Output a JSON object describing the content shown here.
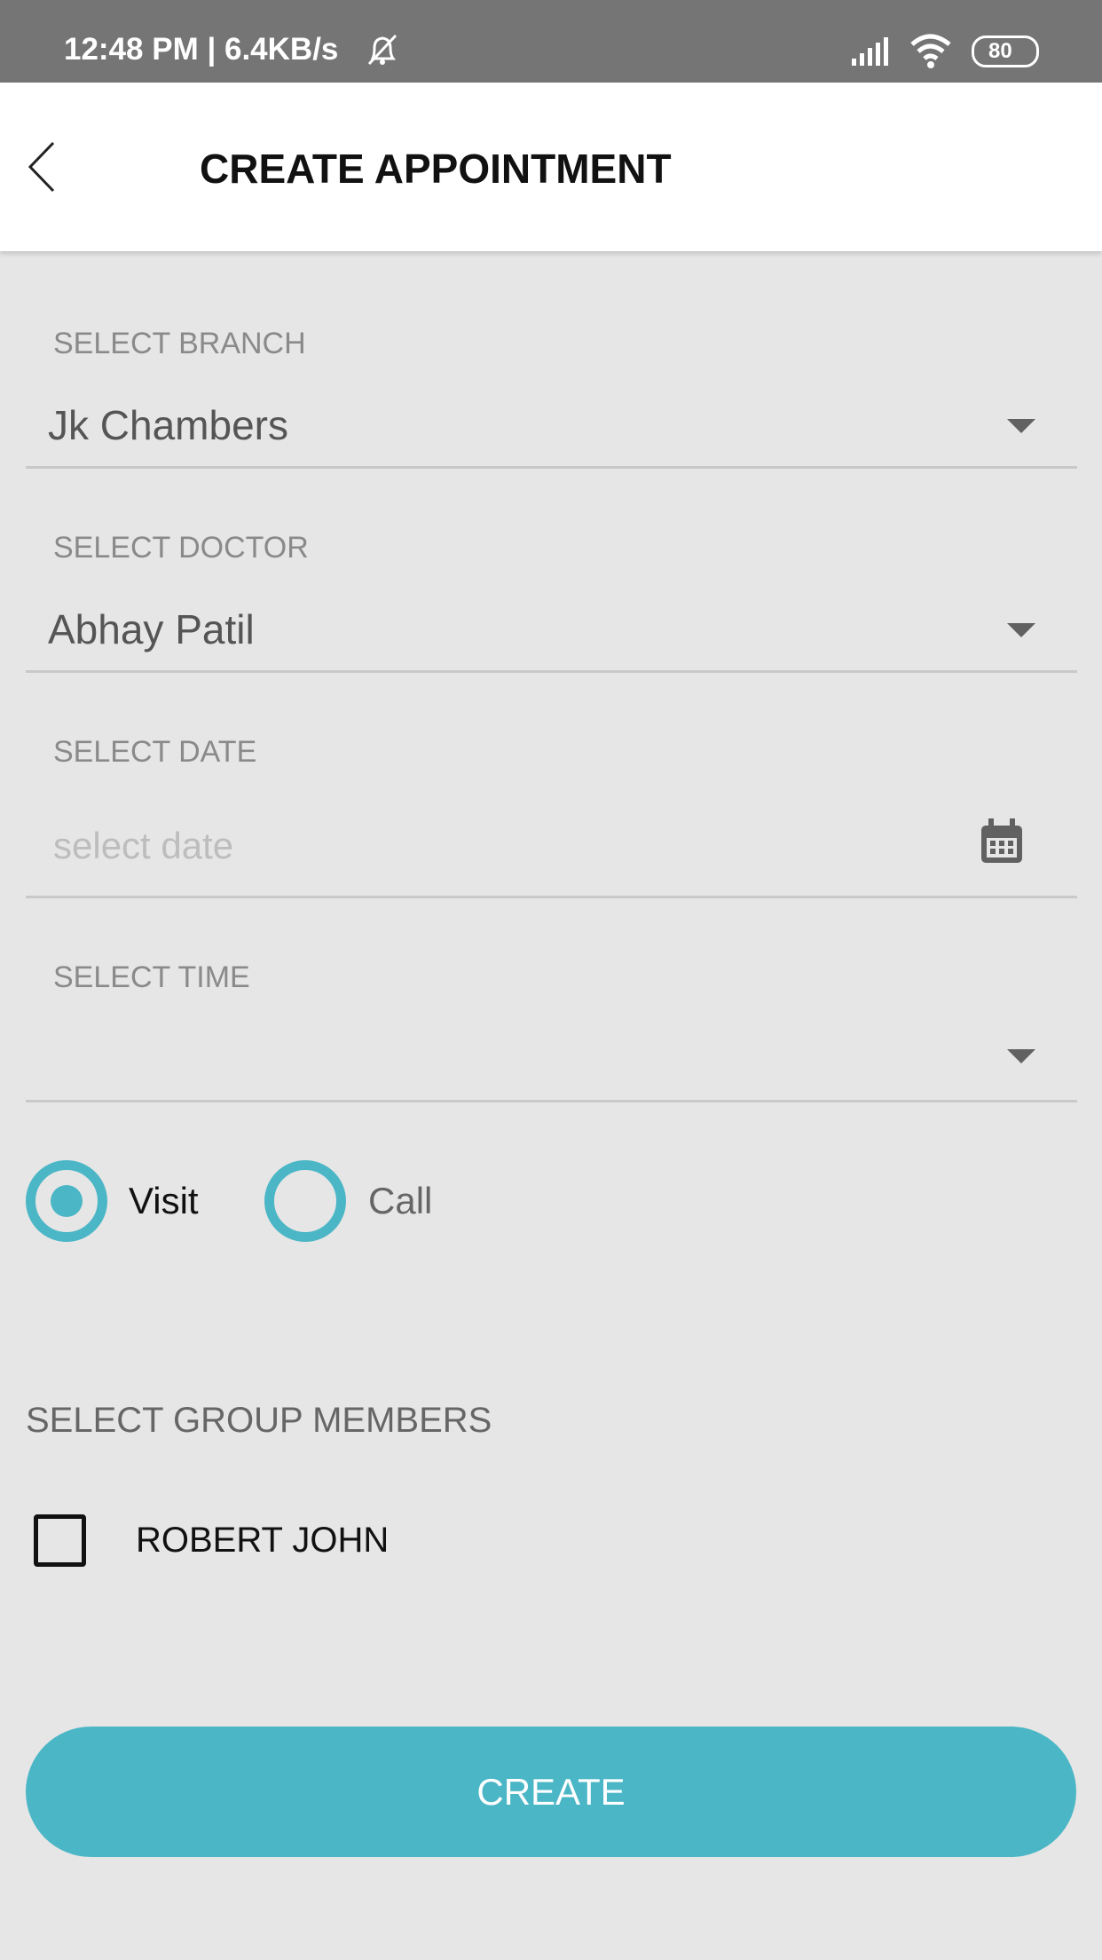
{
  "status_bar": {
    "time_speed": "12:48 PM | 6.4KB/s",
    "battery": "80",
    "icons": [
      "bell-off-icon",
      "signal-icon",
      "wifi-icon",
      "battery-icon"
    ]
  },
  "header": {
    "title": "CREATE APPOINTMENT",
    "back_icon": "chevron-left-icon"
  },
  "form": {
    "branch": {
      "label": "SELECT BRANCH",
      "value": "Jk Chambers"
    },
    "doctor": {
      "label": "SELECT DOCTOR",
      "value": "Abhay Patil"
    },
    "date": {
      "label": "SELECT DATE",
      "placeholder": "select date"
    },
    "time": {
      "label": "SELECT TIME",
      "value": ""
    },
    "mode": {
      "options": [
        "Visit",
        "Call"
      ],
      "selected": "Visit"
    },
    "group": {
      "label": "SELECT GROUP MEMBERS",
      "members": [
        {
          "name": "ROBERT JOHN",
          "checked": false
        }
      ]
    }
  },
  "create_button": "CREATE",
  "colors": {
    "accent": "#4bb6c6",
    "status_bar": "#757575",
    "background": "#e6e6e6"
  }
}
